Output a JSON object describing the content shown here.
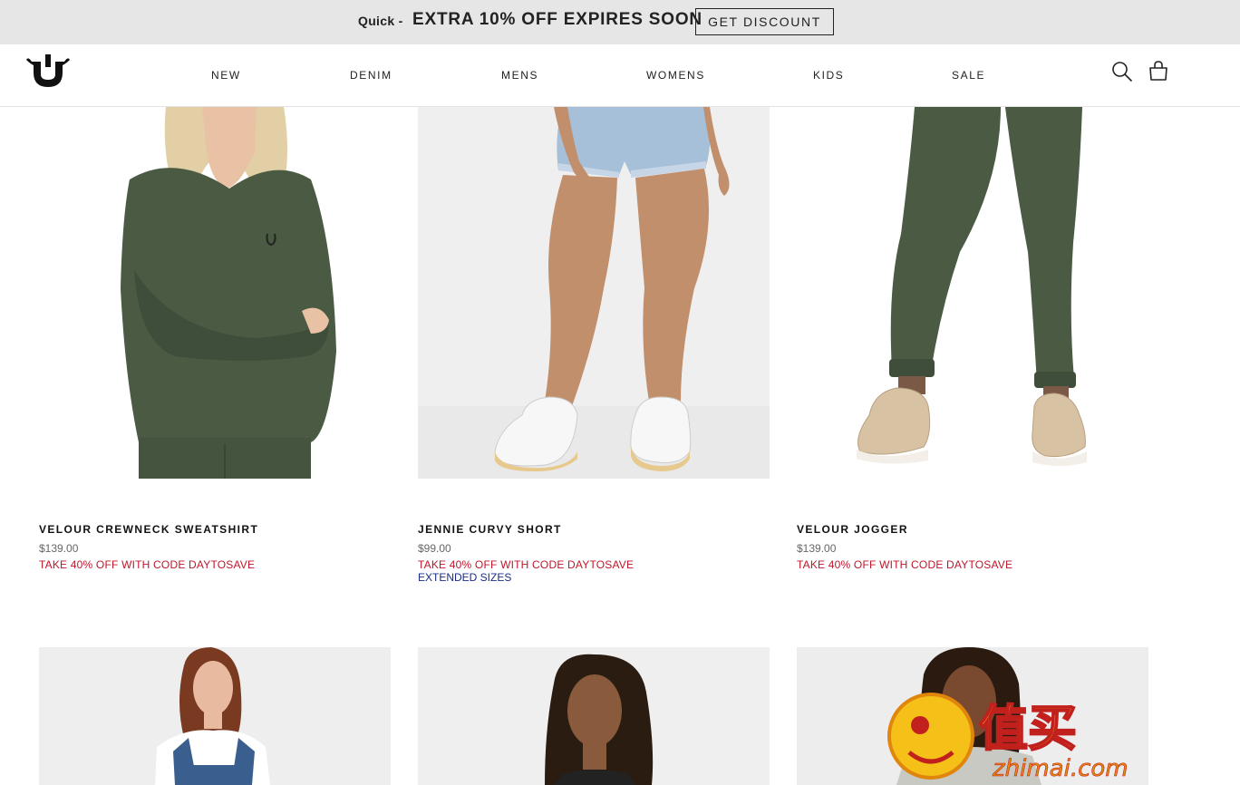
{
  "promo": {
    "quick_label": "Quick -",
    "message": "EXTRA 10% OFF EXPIRES SOON",
    "button_label": "GET DISCOUNT"
  },
  "nav": {
    "items": [
      "NEW",
      "DENIM",
      "MENS",
      "WOMENS",
      "KIDS",
      "SALE"
    ]
  },
  "header": {
    "logo_icon": "horseshoe-logo-icon",
    "search_icon": "search-icon",
    "bag_icon": "shopping-bag-icon"
  },
  "products": [
    {
      "name": "VELOUR CREWNECK SWEATSHIRT",
      "price": "$139.00",
      "promo": "TAKE 40% OFF WITH CODE DAYTOSAVE",
      "extended": ""
    },
    {
      "name": "JENNIE CURVY SHORT",
      "price": "$99.00",
      "promo": "TAKE 40% OFF WITH CODE DAYTOSAVE",
      "extended": "EXTENDED SIZES"
    },
    {
      "name": "VELOUR JOGGER",
      "price": "$139.00",
      "promo": "TAKE 40% OFF WITH CODE DAYTOSAVE",
      "extended": ""
    }
  ],
  "watermark": {
    "brand": "值买",
    "domain": "zhimai.com"
  },
  "colors": {
    "promo_bar": "#e6e6e6",
    "promo_red": "#c0162a",
    "extended_blue": "#1c2c8a",
    "olive_garment": "#4a5a43"
  }
}
